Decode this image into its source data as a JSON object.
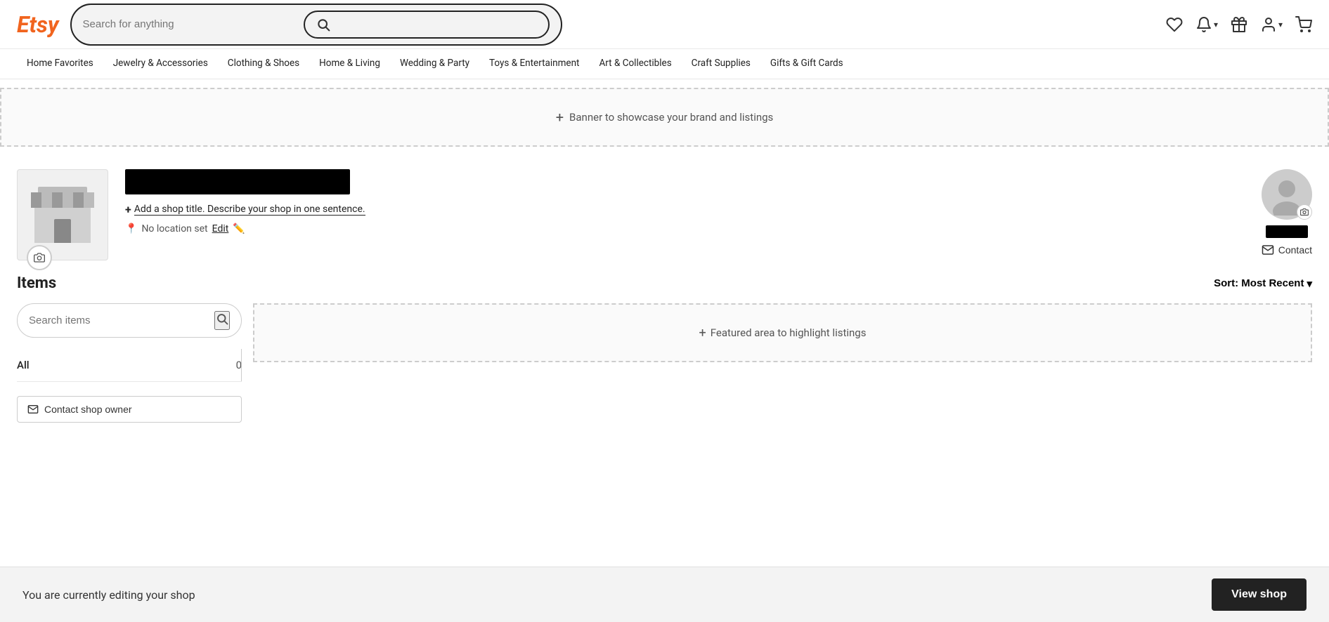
{
  "header": {
    "logo": "Etsy",
    "search_placeholder": "Search for anything",
    "icons": {
      "heart": "♡",
      "bell": "🔔",
      "gift": "🎁",
      "user": "👤",
      "cart": "🛒"
    }
  },
  "nav": {
    "items": [
      {
        "label": "Home Favorites"
      },
      {
        "label": "Jewelry & Accessories"
      },
      {
        "label": "Clothing & Shoes"
      },
      {
        "label": "Home & Living"
      },
      {
        "label": "Wedding & Party"
      },
      {
        "label": "Toys & Entertainment"
      },
      {
        "label": "Art & Collectibles"
      },
      {
        "label": "Craft Supplies"
      },
      {
        "label": "Gifts & Gift Cards"
      }
    ]
  },
  "banner": {
    "plus": "+",
    "label": "Banner to showcase your brand and listings"
  },
  "shop": {
    "add_title_plus": "+",
    "add_title_link": "Add a shop title. Describe your shop in one sentence.",
    "location_label": "No location set",
    "edit_label": "Edit",
    "contact_label": "Contact"
  },
  "items": {
    "title": "Items",
    "sort_label": "Sort: Most Recent",
    "sort_chevron": "▾",
    "search_placeholder": "Search items",
    "all_label": "All",
    "all_count": "0",
    "featured_plus": "+",
    "featured_label": "Featured area to highlight listings",
    "contact_shop_owner": "Contact shop owner"
  },
  "bottom_bar": {
    "message": "You are currently editing your shop",
    "view_shop": "View shop"
  }
}
